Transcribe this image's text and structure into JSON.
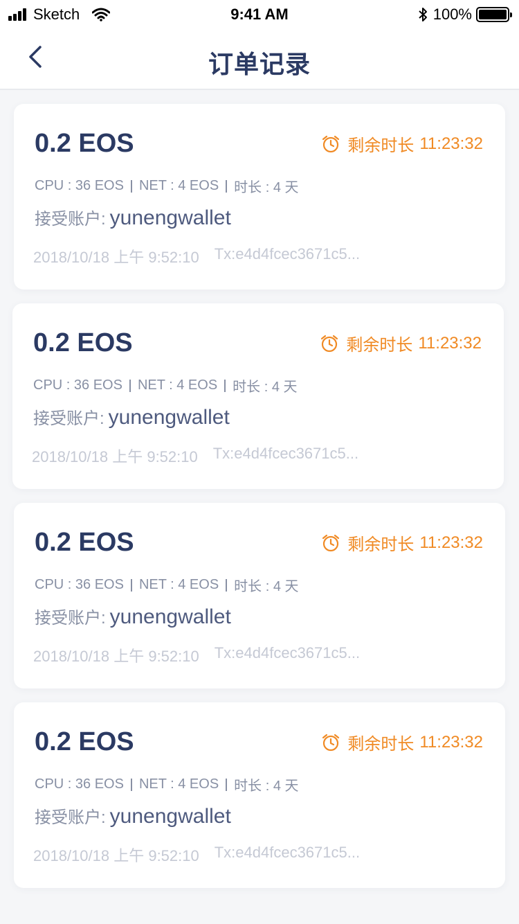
{
  "status_bar": {
    "carrier": "Sketch",
    "time": "9:41 AM",
    "battery": "100%"
  },
  "nav": {
    "title": "订单记录",
    "back_icon": "chevron-left-icon"
  },
  "orders": [
    {
      "amount": "0.2 EOS",
      "remaining_label": "剩余时长",
      "remaining_time": "11:23:32",
      "cpu": "CPU : 36 EOS",
      "net": "NET : 4 EOS",
      "duration": "时长 : 4 天",
      "receiver_label": "接受账户:",
      "receiver": "yunengwallet",
      "datetime": "2018/10/18 上午 9:52:10",
      "tx": "Tx:e4d4fcec3671c5..."
    },
    {
      "amount": "0.2 EOS",
      "remaining_label": "剩余时长",
      "remaining_time": "11:23:32",
      "cpu": "CPU : 36 EOS",
      "net": "NET : 4 EOS",
      "duration": "时长 : 4 天",
      "receiver_label": "接受账户:",
      "receiver": "yunengwallet",
      "datetime": "2018/10/18 上午 9:52:10",
      "tx": "Tx:e4d4fcec3671c5..."
    },
    {
      "amount": "0.2 EOS",
      "remaining_label": "剩余时长",
      "remaining_time": "11:23:32",
      "cpu": "CPU : 36 EOS",
      "net": "NET : 4 EOS",
      "duration": "时长 : 4 天",
      "receiver_label": "接受账户:",
      "receiver": "yunengwallet",
      "datetime": "2018/10/18 上午 9:52:10",
      "tx": "Tx:e4d4fcec3671c5..."
    },
    {
      "amount": "0.2 EOS",
      "remaining_label": "剩余时长",
      "remaining_time": "11:23:32",
      "cpu": "CPU : 36 EOS",
      "net": "NET : 4 EOS",
      "duration": "时长 : 4 天",
      "receiver_label": "接受账户:",
      "receiver": "yunengwallet",
      "datetime": "2018/10/18 上午 9:52:10",
      "tx": "Tx:e4d4fcec3671c5..."
    }
  ],
  "colors": {
    "primary_text": "#2b3a63",
    "accent_orange": "#f08a24",
    "secondary_text": "#8890a4",
    "muted_text": "#c5c9d4",
    "background": "#f5f6f8"
  }
}
